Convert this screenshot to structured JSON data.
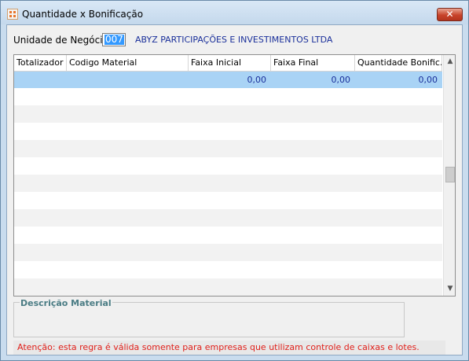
{
  "window": {
    "title": "Quantidade x Bonificação",
    "close_label": "✕"
  },
  "unit": {
    "label": "Unidade de Negócio",
    "code": "007",
    "name": "ABYZ PARTICIPAÇÕES E INVESTIMENTOS LTDA"
  },
  "grid": {
    "columns": [
      "Totalizador",
      "Codigo Material",
      "Faixa Inicial",
      "Faixa Final",
      "Quantidade Bonific..."
    ],
    "selected_row": {
      "faixa_inicial": "0,00",
      "faixa_final": "0,00",
      "quantidade": "0,00"
    },
    "scroll_up": "▲",
    "scroll_down": "▼"
  },
  "description": {
    "title": "Descrição Material"
  },
  "warning": {
    "text": "Atenção: esta regra é válida somente para empresas que utilizam controle de caixas e lotes."
  },
  "colors": {
    "accent_selection": "#a9d3f5",
    "value_text": "#1a2f9a",
    "warning_text": "#e0201a"
  }
}
